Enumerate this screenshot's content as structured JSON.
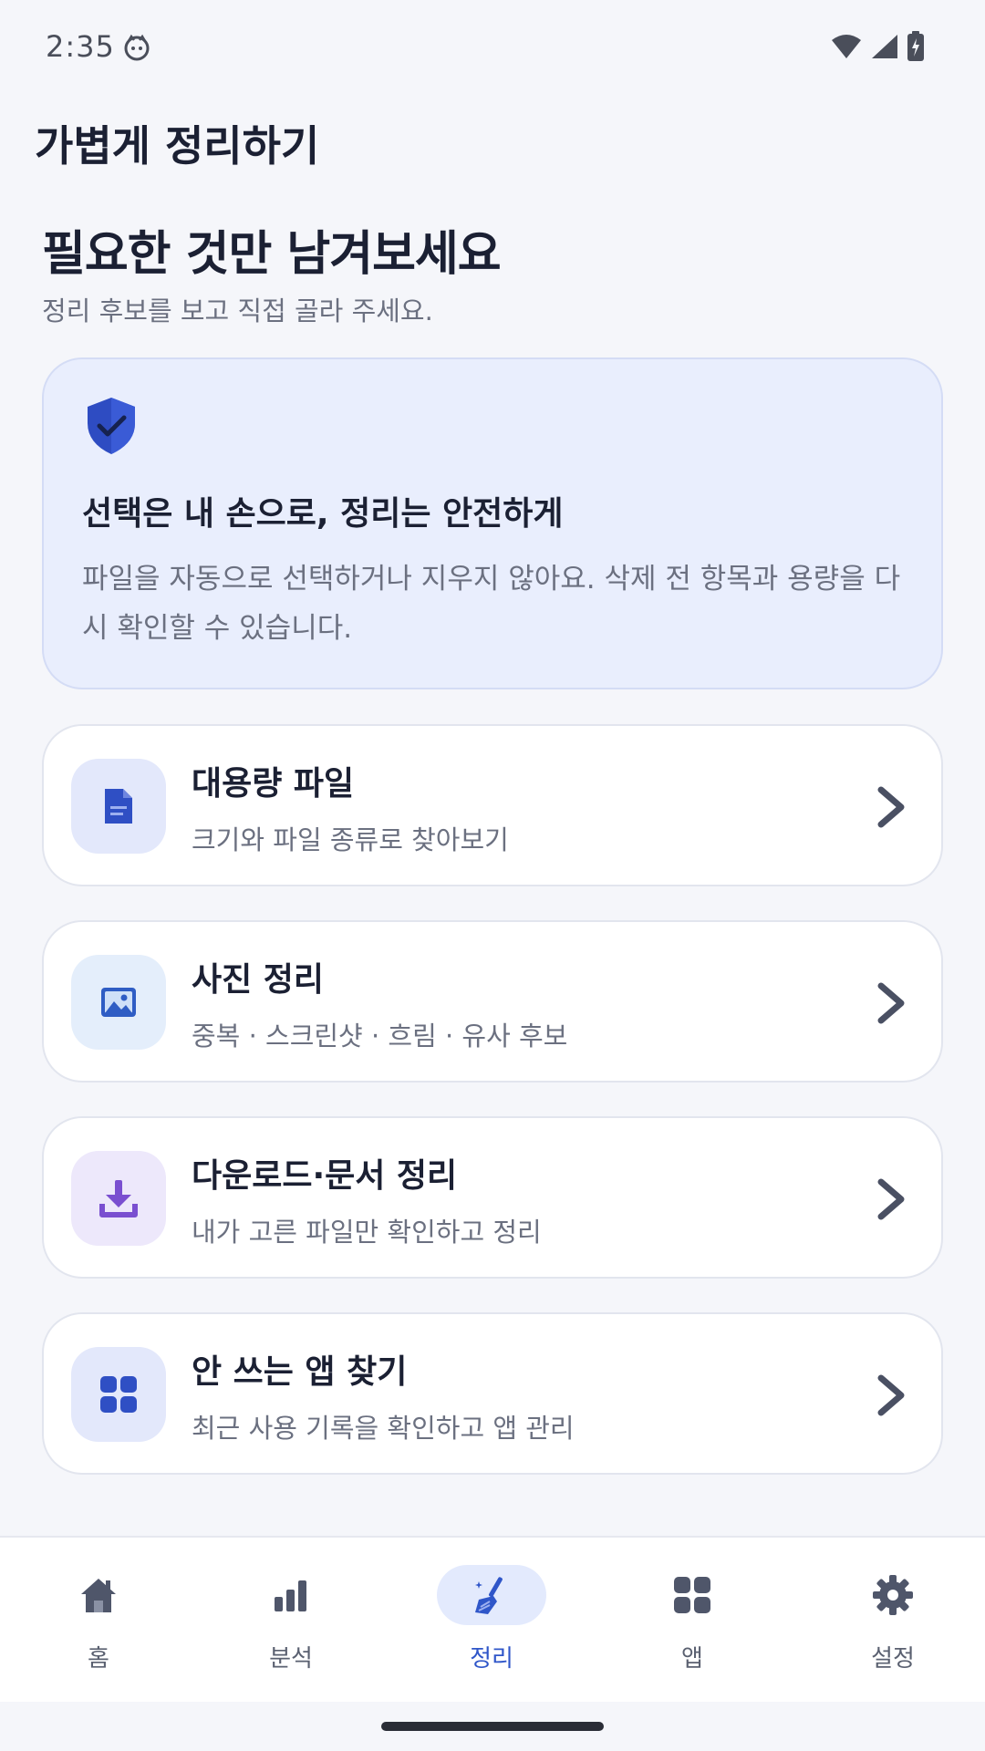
{
  "status_bar": {
    "time": "2:35"
  },
  "header": {
    "title": "가볍게 정리하기"
  },
  "hero": {
    "headline": "필요한 것만 남겨보세요",
    "subhead": "정리 후보를 보고 직접 골라 주세요."
  },
  "info_card": {
    "icon": "shield-check-icon",
    "title": "선택은 내 손으로, 정리는 안전하게",
    "body": "파일을 자동으로 선택하거나 지우지 않아요. 삭제 전 항목과 용량을 다시 확인할 수 있습니다."
  },
  "cards": [
    {
      "icon": "document-icon",
      "title": "대용량 파일",
      "subtitle": "크기와 파일 종류로 찾아보기",
      "icon_bg": "#E3E8FB",
      "icon_color": "#2F4FC4"
    },
    {
      "icon": "image-icon",
      "title": "사진 정리",
      "subtitle": "중복 · 스크린샷 · 흐림 · 유사 후보",
      "icon_bg": "#E4EEFB",
      "icon_color": "#2F5DC4"
    },
    {
      "icon": "download-icon",
      "title": "다운로드·문서 정리",
      "subtitle": "내가 고른 파일만 확인하고 정리",
      "icon_bg": "#EDE8FB",
      "icon_color": "#7A4FD0"
    },
    {
      "icon": "apps-grid-icon",
      "title": "안 쓰는 앱 찾기",
      "subtitle": "최근 사용 기록을 확인하고 앱 관리",
      "icon_bg": "#E3E8FB",
      "icon_color": "#2F4FC4"
    }
  ],
  "bottom_nav": {
    "items": [
      {
        "label": "홈",
        "icon": "home-icon",
        "active": false
      },
      {
        "label": "분석",
        "icon": "bar-chart-icon",
        "active": false
      },
      {
        "label": "정리",
        "icon": "broom-icon",
        "active": true
      },
      {
        "label": "앱",
        "icon": "apps-icon",
        "active": false
      },
      {
        "label": "설정",
        "icon": "gear-icon",
        "active": false
      }
    ]
  },
  "colors": {
    "accent": "#2F56C9",
    "background": "#F5F6FA",
    "info_card_bg": "#E9EEFD",
    "text_primary": "#1B2033",
    "text_secondary": "#6B7080"
  }
}
